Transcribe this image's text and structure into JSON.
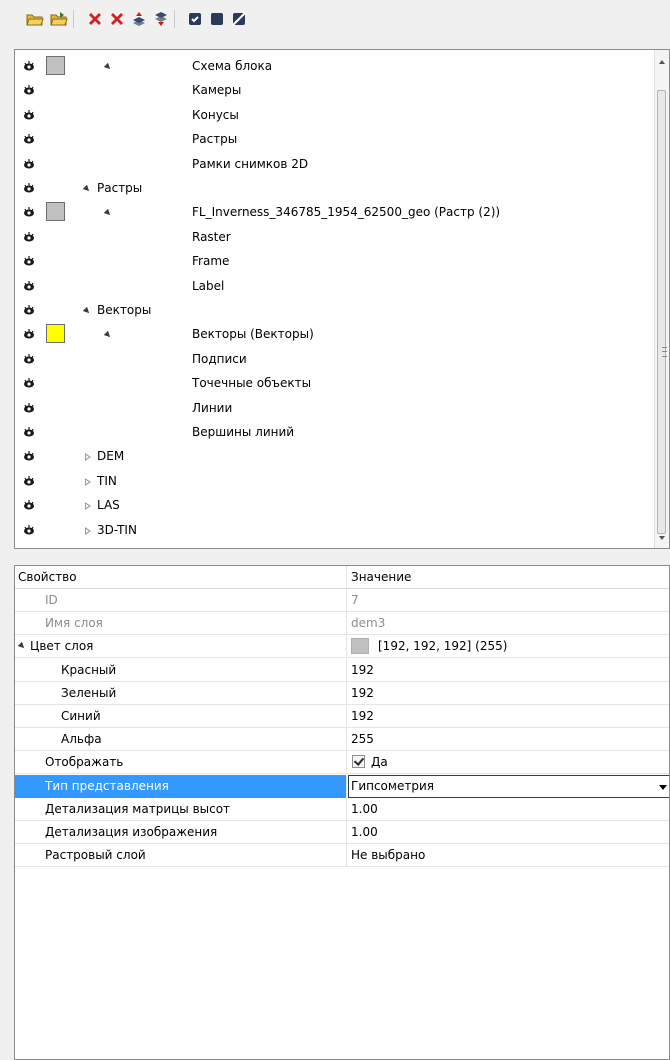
{
  "toolbar": {
    "buttons": [
      {
        "name": "open-folder-icon",
        "color": "#e8b830"
      },
      {
        "name": "open-folder-arrow-icon",
        "color": "#e8b830"
      },
      {
        "name": "delete-icon",
        "color": "#d42020"
      },
      {
        "name": "delete-all-icon",
        "color": "#d42020"
      },
      {
        "name": "layer-up-icon",
        "color": "#3a4a6a"
      },
      {
        "name": "layer-down-icon",
        "color": "#3a4a6a"
      },
      {
        "name": "check-all-icon",
        "color": "#2a3a5a"
      },
      {
        "name": "uncheck-all-icon",
        "color": "#2a3a5a"
      },
      {
        "name": "invert-check-icon",
        "color": "#2a3a5a"
      }
    ]
  },
  "tree": {
    "rows": [
      {
        "text": "Схема блока",
        "swatch": "#c0c0c0",
        "expander": "down",
        "level": 2
      },
      {
        "text": "Камеры",
        "swatch": null,
        "expander": null,
        "level": 2
      },
      {
        "text": "Конусы",
        "swatch": null,
        "expander": null,
        "level": 2
      },
      {
        "text": "Растры",
        "swatch": null,
        "expander": null,
        "level": 2
      },
      {
        "text": "Рамки снимков 2D",
        "swatch": null,
        "expander": null,
        "level": 2
      },
      {
        "text": "Растры",
        "swatch": null,
        "expander": "down",
        "level": 1
      },
      {
        "text": "FL_Inverness_346785_1954_62500_geo (Растр (2))",
        "swatch": "#c0c0c0",
        "expander": "down",
        "level": 2
      },
      {
        "text": "Raster",
        "swatch": null,
        "expander": null,
        "level": 2
      },
      {
        "text": "Frame",
        "swatch": null,
        "expander": null,
        "level": 2
      },
      {
        "text": "Label",
        "swatch": null,
        "expander": null,
        "level": 2
      },
      {
        "text": "Векторы",
        "swatch": null,
        "expander": "down",
        "level": 1
      },
      {
        "text": "Векторы (Векторы)",
        "swatch": "#ffff00",
        "expander": "down",
        "level": 2
      },
      {
        "text": "Подписи",
        "swatch": null,
        "expander": null,
        "level": 2
      },
      {
        "text": "Точечные объекты",
        "swatch": null,
        "expander": null,
        "level": 2
      },
      {
        "text": "Линии",
        "swatch": null,
        "expander": null,
        "level": 2
      },
      {
        "text": "Вершины линий",
        "swatch": null,
        "expander": null,
        "level": 2
      },
      {
        "text": "DEM",
        "swatch": null,
        "expander": "right",
        "level": 1
      },
      {
        "text": "TIN",
        "swatch": null,
        "expander": "right",
        "level": 1
      },
      {
        "text": "LAS",
        "swatch": null,
        "expander": "right",
        "level": 1
      },
      {
        "text": "3D-TIN",
        "swatch": null,
        "expander": "right",
        "level": 1
      }
    ]
  },
  "props": {
    "header": {
      "name": "Свойство",
      "value": "Значение"
    },
    "rows": [
      {
        "name": "ID",
        "value": "7",
        "indent": 1,
        "state": "disabled"
      },
      {
        "name": "Имя слоя",
        "value": "dem3",
        "indent": 1,
        "state": "disabled"
      },
      {
        "name": "Цвет слоя",
        "value": "[192, 192, 192] (255)",
        "indent": 0,
        "state": "group",
        "color": "#c0c0c0"
      },
      {
        "name": "Красный",
        "value": "192",
        "indent": 2,
        "state": "normal"
      },
      {
        "name": "Зеленый",
        "value": "192",
        "indent": 2,
        "state": "normal"
      },
      {
        "name": "Синий",
        "value": "192",
        "indent": 2,
        "state": "normal"
      },
      {
        "name": "Альфа",
        "value": "255",
        "indent": 2,
        "state": "normal"
      },
      {
        "name": "Отображать",
        "value": "Да",
        "indent": 1,
        "state": "checkbox"
      },
      {
        "name": "Тип представления",
        "value": "Гипсометрия",
        "indent": 1,
        "state": "selected"
      },
      {
        "name": "Детализация матрицы высот",
        "value": "1.00",
        "indent": 1,
        "state": "normal"
      },
      {
        "name": "Детализация изображения",
        "value": "1.00",
        "indent": 1,
        "state": "normal"
      },
      {
        "name": "Растровый слой",
        "value": "Не выбрано",
        "indent": 1,
        "state": "normal"
      }
    ]
  }
}
